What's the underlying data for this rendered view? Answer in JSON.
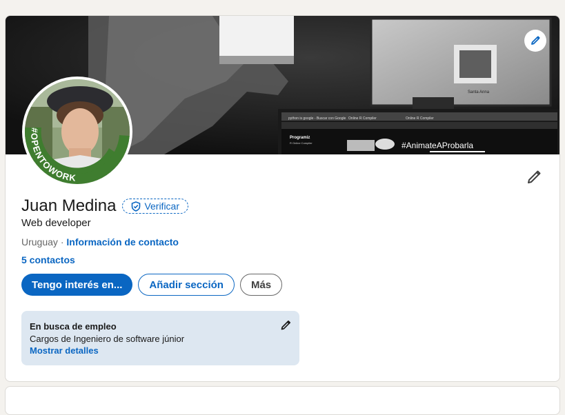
{
  "profile": {
    "name": "Juan Medina",
    "verify_label": "Verificar",
    "headline": "Web developer",
    "location": "Uruguay",
    "separator": "·",
    "contact_info_label": "Información de contacto",
    "connections_label": "5 contactos",
    "frame_badge_text": "#OPENTOWORK"
  },
  "banner": {
    "screen_text": "#AnimateAProbarla",
    "tab_text_1": "python is google - Buscar con Google",
    "tab_text_2": "Online R Compiler",
    "tab_text_3": "Online R Compiler",
    "site_label": "Programiz",
    "site_sublabel": "R Online Compiler",
    "monitor_caption": "Santa Anna"
  },
  "actions": {
    "open_to_label": "Tengo interés en...",
    "add_section_label": "Añadir sección",
    "more_label": "Más"
  },
  "open_to_work": {
    "title": "En busca de empleo",
    "description": "Cargos de Ingeniero de software júnior",
    "details_link": "Mostrar detalles"
  },
  "icons": {
    "banner_edit": "pencil-icon",
    "profile_edit": "pencil-icon",
    "verify": "shield-check-icon",
    "open_to_work_edit": "pencil-icon"
  },
  "colors": {
    "accent": "#0a66c2",
    "open_to_work_green": "#3f7d2f",
    "open_to_work_card": "#dde7f1",
    "page_background": "#f4f2ee"
  }
}
